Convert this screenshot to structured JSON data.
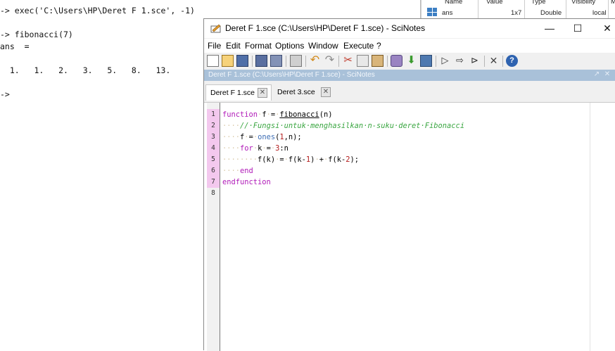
{
  "console": {
    "lines": [
      "-> exec('C:\\Users\\HP\\Deret F 1.sce', -1)",
      "-> fibonacci(7)",
      "ans  =",
      "  1.   1.   2.   3.   5.   8.   13.",
      "->"
    ]
  },
  "variable_browser": {
    "headers": [
      "Name",
      "Value",
      "Type",
      "Visibility",
      "M"
    ],
    "row": {
      "name": "ans",
      "value": "1x7",
      "type": "Double",
      "visibility": "local"
    }
  },
  "window": {
    "title": "Deret F 1.sce (C:\\Users\\HP\\Deret F 1.sce) - SciNotes",
    "controls": {
      "minimize": "—",
      "maximize": "☐",
      "close": "✕"
    }
  },
  "menu": [
    "File",
    "Edit",
    "Format",
    "Options",
    "Window",
    "Execute",
    "?"
  ],
  "toolbar": {
    "icons": [
      "new-file-icon",
      "open-file-icon",
      "open-folder-icon",
      "save-icon",
      "save-as-icon",
      "print-icon",
      "undo-icon",
      "redo-icon",
      "cut-icon",
      "copy-icon",
      "paste-icon",
      "find-icon",
      "download-icon",
      "variables-icon",
      "run-icon",
      "run-echo-icon",
      "run-file-icon",
      "tools-icon",
      "help-icon"
    ]
  },
  "docbar": {
    "title": "Deret F 1.sce (C:\\Users\\HP\\Deret F 1.sce) - SciNotes"
  },
  "tabs": [
    {
      "label": "Deret F 1.sce"
    },
    {
      "label": "Deret 3.sce"
    }
  ],
  "editor": {
    "line_numbers": [
      "1",
      "2",
      "3",
      "4",
      "5",
      "6",
      "7",
      "8"
    ],
    "marked_lines": 7
  },
  "colors": {
    "keyword": "#b01ab8",
    "comment": "#3aa641",
    "builtin": "#3f6fb5",
    "number": "#b21a1a",
    "docbar": "#a9c1d9",
    "gutter_mark": "#f3c8ee"
  }
}
